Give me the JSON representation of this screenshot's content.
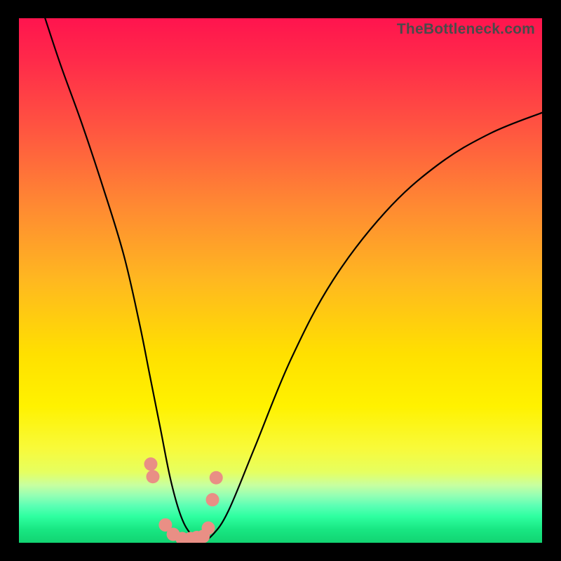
{
  "watermark": "TheBottleneck.com",
  "chart_data": {
    "type": "line",
    "title": "",
    "xlabel": "",
    "ylabel": "",
    "xlim": [
      0,
      100
    ],
    "ylim": [
      0,
      100
    ],
    "series": [
      {
        "name": "bottleneck-curve",
        "x": [
          5,
          8,
          12,
          16,
          20,
          23,
          25,
          27,
          29,
          31,
          33,
          35,
          37,
          40,
          45,
          52,
          60,
          70,
          80,
          90,
          100
        ],
        "values": [
          100,
          91,
          80,
          68,
          55,
          42,
          32,
          22,
          12,
          5,
          1.5,
          0.5,
          1.5,
          6,
          18,
          35,
          50,
          63,
          72,
          78,
          82
        ]
      }
    ],
    "markers": {
      "name": "highlight-dots",
      "color": "#e98f85",
      "x": [
        25.2,
        25.6,
        28.0,
        29.5,
        31.2,
        32.8,
        34.0,
        35.2,
        36.2,
        37.0,
        37.7
      ],
      "values": [
        15.0,
        12.6,
        3.4,
        1.6,
        0.8,
        0.8,
        1.0,
        1.2,
        2.8,
        8.2,
        12.4
      ]
    }
  }
}
